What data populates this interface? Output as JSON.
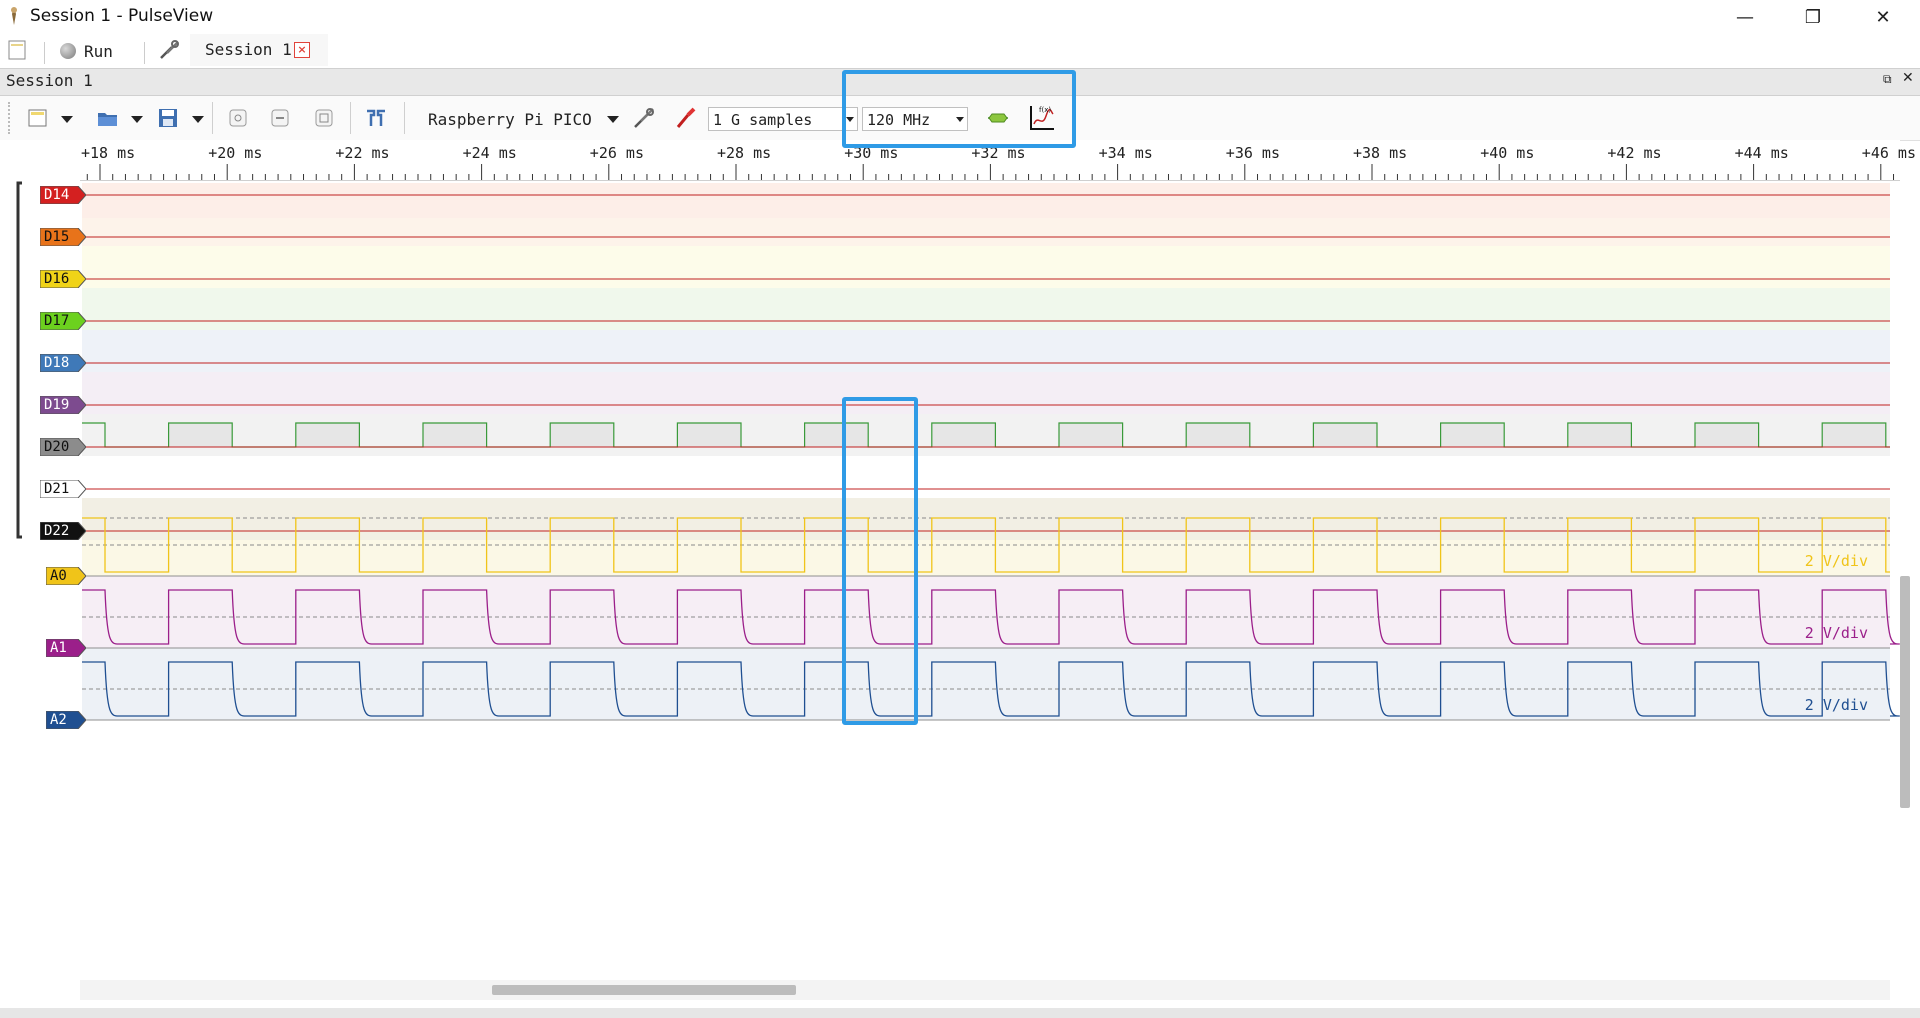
{
  "window": {
    "title": "Session 1 - PulseView"
  },
  "mainbar": {
    "run_label": "Run",
    "tab_label": "Session 1",
    "tab_close": "×"
  },
  "session": {
    "header_label": "Session 1",
    "device": "Raspberry Pi PICO",
    "samples": "1 G samples",
    "samplerate": "120 MHz"
  },
  "ruler": {
    "ticks": [
      "+18 ms",
      "+20 ms",
      "+22 ms",
      "+24 ms",
      "+26 ms",
      "+28 ms",
      "+30 ms",
      "+32 ms",
      "+34 ms",
      "+36 ms",
      "+38 ms",
      "+40 ms",
      "+42 ms",
      "+44 ms",
      "+46 ms"
    ]
  },
  "channels": [
    {
      "name": "D14",
      "color": "#d42020",
      "band": "#fdeee8",
      "kind": "low"
    },
    {
      "name": "D15",
      "color": "#e8731a",
      "band": "#fdf3ea",
      "kind": "low"
    },
    {
      "name": "D16",
      "color": "#f0d318",
      "band": "#fdfcea",
      "kind": "low"
    },
    {
      "name": "D17",
      "color": "#6cd11e",
      "band": "#f0f8ec",
      "kind": "low"
    },
    {
      "name": "D18",
      "color": "#3f79b8",
      "band": "#eef2f8",
      "kind": "low"
    },
    {
      "name": "D19",
      "color": "#7d4b8f",
      "band": "#f4eef5",
      "kind": "low"
    },
    {
      "name": "D20",
      "color": "#8c8c8c",
      "band": "#f2f2f2",
      "kind": "clock"
    },
    {
      "name": "D21",
      "color": "#ffffff",
      "band": "#ffffff",
      "kind": "low"
    },
    {
      "name": "D22",
      "color": "#111111",
      "band": "#f2efe4",
      "kind": "low"
    },
    {
      "name": "A0",
      "color": "#f0c419",
      "band": "#fbf8e6",
      "kind": "analog",
      "scale": "2 V/div"
    },
    {
      "name": "A1",
      "color": "#9b1f8a",
      "band": "#f6eef5",
      "kind": "analog",
      "scale": "2 V/div"
    },
    {
      "name": "A2",
      "color": "#1f4f91",
      "band": "#edf1f6",
      "kind": "analog",
      "scale": "2 V/div"
    }
  ],
  "colors": {
    "highlight": "#2f9be6",
    "digital_low": "#c02020",
    "digital_high": "#2f9a2f"
  }
}
